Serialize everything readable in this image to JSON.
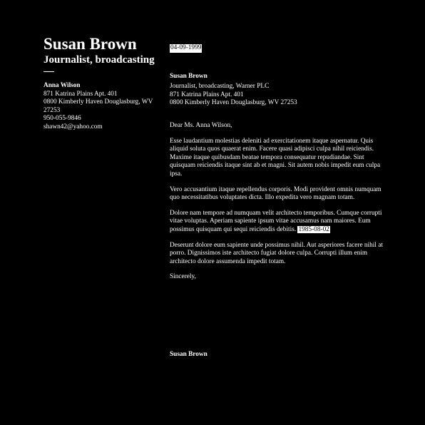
{
  "header": {
    "name": "Susan Brown",
    "title": "Journalist, broadcasting",
    "dash": "—"
  },
  "contact": {
    "name": "Anna Wilson",
    "address_line1": "871 Katrina Plains Apt. 401",
    "address_line2": "0800 Kimberly Haven Douglasburg, WV 27253",
    "phone": "950-055-9846",
    "email": "shawn42@yahoo.com"
  },
  "letter": {
    "date": "04-09-1999",
    "sender_name": "Susan Brown",
    "sender_org": "Journalist, broadcasting, Warner PLC",
    "sender_address_line1": "871 Katrina Plains Apt. 401",
    "sender_address_line2": "0800 Kimberly Haven Douglasburg, WV 27253",
    "greeting": "Dear Ms. Anna Wilson,",
    "paragraph1": "Esse laudantium molestias deleniti ad exercitationem itaque aspernatur. Quis aliquid soluta quos quaerat enim. Facere quasi adipisci culpa nihil reiciendis. Maxime itaque quibusdam beatae tempora consequatur repudiandae. Sint quisquam reiciendis itaque sint ab et magni. Sit autem nobis impedit eum culpa ipsa.",
    "paragraph2": "Vero accusantium itaque repellendus corporis. Modi provident omnis numquam quo necessitatibus voluptates dicta. Illo expedita vero magnam totam.",
    "paragraph3": "Dolore nam tempore ad numquam velit architecto temporibus. Cumque corrupti vitae voluptas. Aperiam sapiente ipsum vitae accusamus nam maiores. Eum possimus quisquam qui sequi reiciendis debitis.",
    "paragraph3_date": "1985-08-02",
    "paragraph4": "Deserunt dolore eum sapiente unde possimus nihil. Aut asperiores facere nihil at porro. Dignissimos iste architecto fugiat dolore culpa. Corrupti illum enim architecto dolore assumenda impedit totam.",
    "closing": "Sincerely,",
    "signature": "Susan Brown"
  },
  "colors": {
    "background": "#000000",
    "text": "#ffffff",
    "highlight_bg": "#ffffff",
    "highlight_text": "#000000"
  }
}
